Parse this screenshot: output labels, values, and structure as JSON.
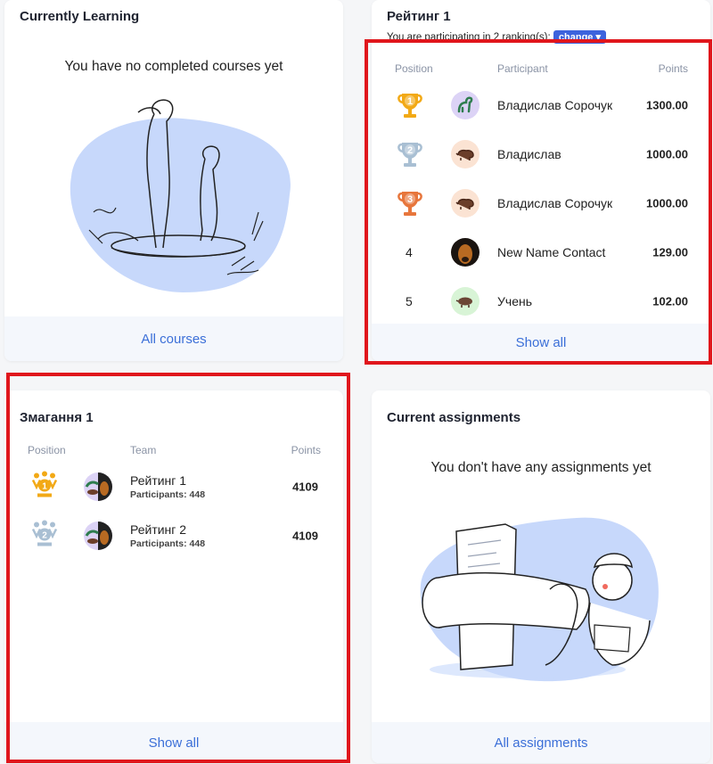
{
  "learning": {
    "title": "Currently Learning",
    "empty_message": "You have no completed courses yet",
    "footer_link": "All courses"
  },
  "ranking": {
    "title": "Рейтинг 1",
    "participating_text": "You are participating in 2 ranking(s):",
    "change_label": "change",
    "headers": {
      "position": "Position",
      "participant": "Participant",
      "points": "Points"
    },
    "rows": [
      {
        "position": "1",
        "name": "Владислав Сорочук",
        "points": "1300.00",
        "avatar": "dinosaur-icon",
        "trophy": "gold"
      },
      {
        "position": "2",
        "name": "Владислав",
        "points": "1000.00",
        "avatar": "bison-icon",
        "trophy": "silver"
      },
      {
        "position": "3",
        "name": "Владислав Сорочук",
        "points": "1000.00",
        "avatar": "bison-icon",
        "trophy": "bronze"
      },
      {
        "position": "4",
        "name": "New Name Contact",
        "points": "129.00",
        "avatar": "dog-photo",
        "trophy": ""
      },
      {
        "position": "5",
        "name": "Учень",
        "points": "102.00",
        "avatar": "boar-icon",
        "trophy": ""
      }
    ],
    "footer_link": "Show all"
  },
  "competition": {
    "title": "Змагання 1",
    "headers": {
      "position": "Position",
      "team": "Team",
      "points": "Points"
    },
    "rows": [
      {
        "position": "1",
        "team": "Рейтинг 1",
        "participants": "Participants: 448",
        "points": "4109"
      },
      {
        "position": "2",
        "team": "Рейтинг 2",
        "participants": "Participants: 448",
        "points": "4109"
      }
    ],
    "footer_link": "Show all"
  },
  "assignments": {
    "title": "Current assignments",
    "empty_message": "You don't have any assignments yet",
    "footer_link": "All assignments"
  },
  "colors": {
    "accent": "#3b6fd8",
    "highlight": "#e0161c",
    "gold": "#f2a916",
    "silver": "#a9bfd3",
    "bronze": "#e7763c",
    "illustration_blob": "#c7d8fb"
  }
}
